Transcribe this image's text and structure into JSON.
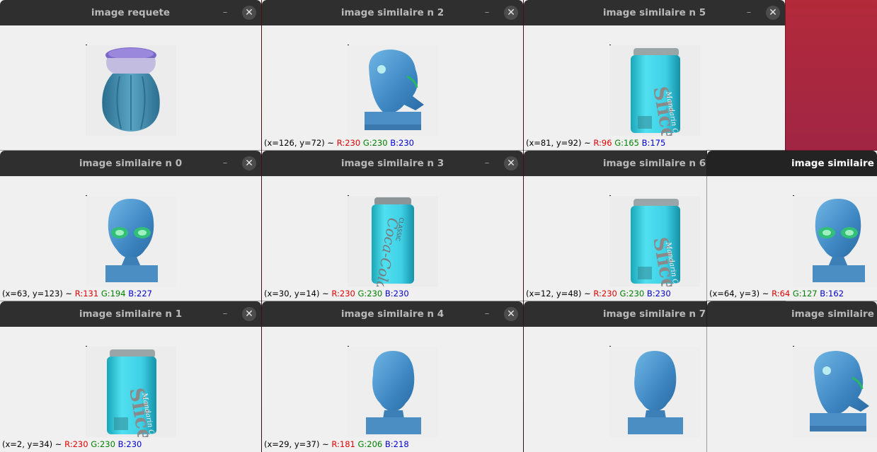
{
  "windows": [
    {
      "title": "image requete",
      "minimize": "–",
      "close": "✕",
      "status": null
    },
    {
      "title": "image similaire n 2",
      "minimize": "–",
      "close": "✕",
      "status": {
        "coords": "(x=126, y=72) ~",
        "r": "R:230",
        "g": "G:230",
        "b": "B:230"
      }
    },
    {
      "title": "image similaire n 5",
      "minimize": "–",
      "close": "✕",
      "status": {
        "coords": "(x=81, y=92) ~",
        "r": "R:96",
        "g": "G:165",
        "b": "B:175"
      }
    },
    {
      "title": "image similaire n 0",
      "minimize": "–",
      "close": "✕",
      "status": {
        "coords": "(x=63, y=123) ~",
        "r": "R:131",
        "g": "G:194",
        "b": "B:227"
      }
    },
    {
      "title": "image similaire n 3",
      "minimize": "–",
      "close": "✕",
      "status": {
        "coords": "(x=30, y=14) ~",
        "r": "R:230",
        "g": "G:230",
        "b": "B:230"
      }
    },
    {
      "title": "image similaire n 6",
      "minimize": "–",
      "close": "✕",
      "status": {
        "coords": "(x=12, y=48) ~",
        "r": "R:230",
        "g": "G:230",
        "b": "B:230"
      }
    },
    {
      "title": "image similaire n",
      "status": {
        "coords": "(x=64, y=3) ~",
        "r": "R:64",
        "g": "G:127",
        "b": "B:162"
      }
    },
    {
      "title": "image similaire n 1",
      "minimize": "–",
      "close": "✕",
      "status": {
        "coords": "(x=2, y=34) ~",
        "r": "R:230",
        "g": "G:230",
        "b": "B:230"
      }
    },
    {
      "title": "image similaire n 4",
      "minimize": "–",
      "close": "✕",
      "status": {
        "coords": "(x=29, y=37) ~",
        "r": "R:181",
        "g": "G:206",
        "b": "B:218"
      }
    },
    {
      "title": "image similaire n 7",
      "minimize": "–",
      "close": "✕",
      "status": null
    },
    {
      "title": "image similaire n",
      "status": null
    }
  ],
  "image_labels": {
    "coca_cola": "Coca-Cola",
    "classic": "CLASSIC",
    "slice": "Slice",
    "mandarin_orange": "Mandarin Orange"
  },
  "colors": {
    "desktop_top": "#b32a3a",
    "titlebar": "#2f2f2f",
    "titlebar_active": "#232323",
    "window_bg": "#f0f0f0",
    "red": "#e00000",
    "green": "#008000",
    "blue": "#0000d0"
  }
}
